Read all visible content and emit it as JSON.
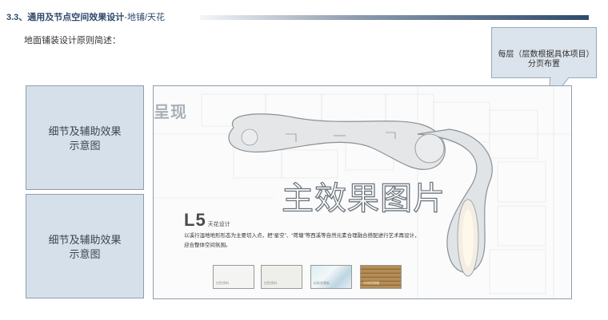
{
  "header": {
    "title": "3.3、通用及节点空间效果设计",
    "title_suffix": "-地铺/天花"
  },
  "subheading": "地面铺装设计原则简述：",
  "callout": {
    "text": "每层（层数根据具体项目）分页布置"
  },
  "side_boxes": [
    {
      "label": "细节及辅助效果\n示意图"
    },
    {
      "label": "细节及辅助效果\n示意图"
    }
  ],
  "main_image": {
    "stamp": "呈现",
    "label": "主效果图片",
    "level_code": "L5",
    "level_name": "天花设计",
    "description": "以溪行湿地地形形态为主要切入点，把“星空”、“荷塘”等西溪等自然元素合理融合搭配进行艺术再设计，迎合整体空间氛围。",
    "swatches": [
      {
        "label": "白色涂料",
        "color": "#f4f4f2"
      },
      {
        "label": "白色涂料",
        "color": "#eeeeea"
      },
      {
        "label": "幻彩金属板",
        "color": "#cfe6ee"
      },
      {
        "label": "木纹铝格栅",
        "color": "#b8935c"
      }
    ]
  },
  "colors": {
    "title": "#2f4a6b",
    "box_fill": "#d6e0ea",
    "box_border": "#8e9eae",
    "callout_fill": "#dbe3ec"
  }
}
